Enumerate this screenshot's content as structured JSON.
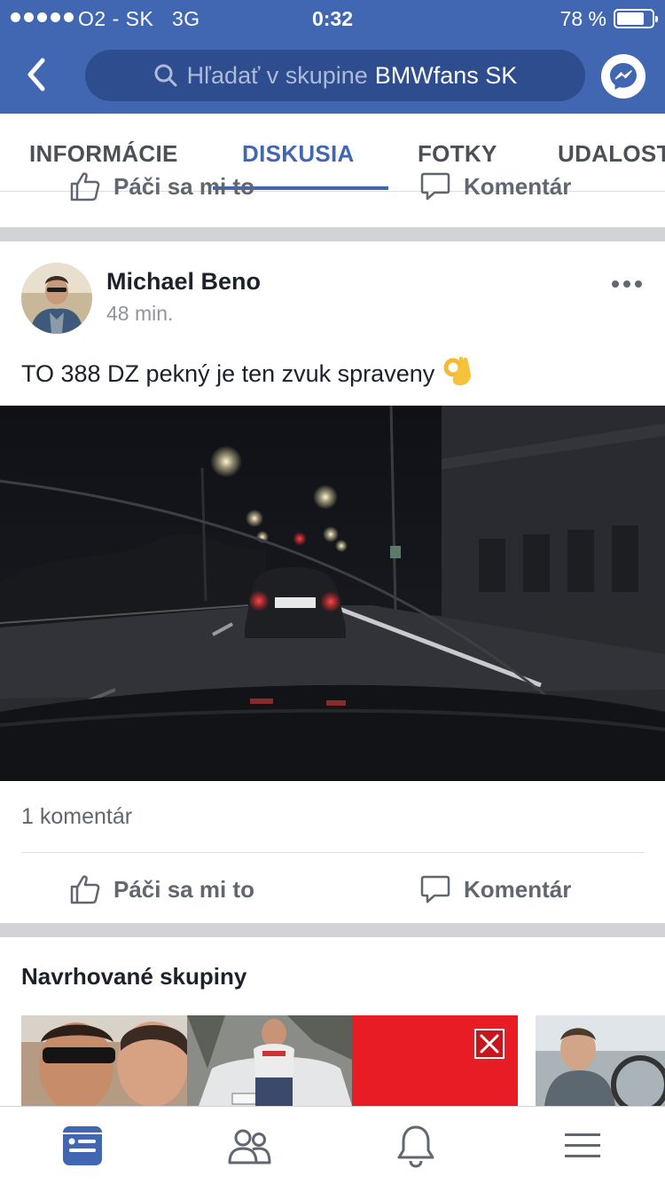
{
  "status_bar": {
    "carrier": "O2 - SK",
    "network": "3G",
    "time": "0:32",
    "battery": "78 %",
    "battery_level": 0.78
  },
  "nav": {
    "search_placeholder": "Hľadať v skupine",
    "group_name": "BMWfans SK"
  },
  "tabs": [
    {
      "label": "INFORMÁCIE",
      "active": false
    },
    {
      "label": "DISKUSIA",
      "active": true
    },
    {
      "label": "FOTKY",
      "active": false
    },
    {
      "label": "UDALOSTI",
      "active": false
    }
  ],
  "previous_post": {
    "like_label": "Páči sa mi to",
    "comment_label": "Komentár"
  },
  "post": {
    "author": "Michael Beno",
    "time": "48 min.",
    "text": "TO 388 DZ  pekný je ten zvuk spraveny",
    "emoji": "👌",
    "comment_count": "1 komentár",
    "like_label": "Páči sa mi to",
    "comment_label": "Komentár"
  },
  "suggested": {
    "title": "Navrhované skupiny"
  },
  "colors": {
    "brand": "#4267b2",
    "search_bg": "#2d4d8f",
    "separator": "#d2d3d7",
    "close_red": "#e0262c"
  }
}
